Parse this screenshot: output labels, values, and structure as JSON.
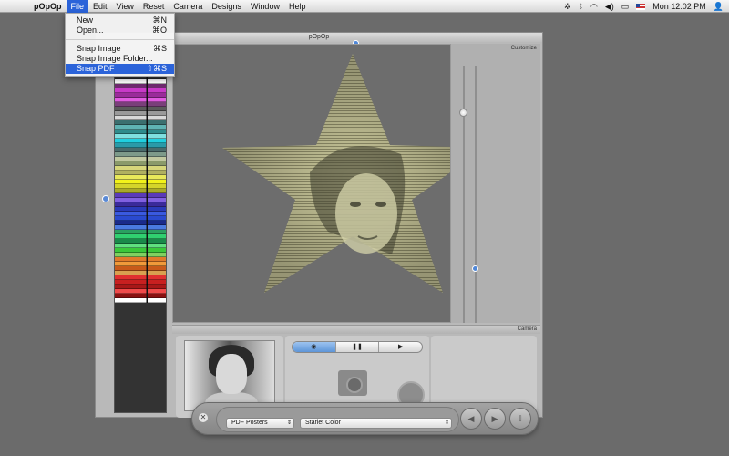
{
  "menubar": {
    "app_name": "pOpOp",
    "items": [
      "File",
      "Edit",
      "View",
      "Reset",
      "Camera",
      "Designs",
      "Window",
      "Help"
    ],
    "active": "File",
    "clock": "Mon 12:02 PM"
  },
  "file_menu": {
    "items": [
      {
        "label": "New",
        "shortcut": "⌘N"
      },
      {
        "label": "Open...",
        "shortcut": "⌘O"
      },
      {
        "label": "Snap Image",
        "shortcut": "⌘S"
      },
      {
        "label": "Snap Image Folder...",
        "shortcut": ""
      },
      {
        "label": "Snap PDF",
        "shortcut": "⇧⌘S"
      }
    ],
    "selected": "Snap PDF"
  },
  "window": {
    "title": "pOpOp",
    "customize_label": "Customize",
    "camera_label": "Camera"
  },
  "camera_controls": {
    "capture_glyph": "◉",
    "pause_glyph": "❚❚",
    "play_glyph": "▶"
  },
  "hud": {
    "close_glyph": "✕",
    "category_select": "PDF Posters",
    "style_select": "Starlet Color",
    "prev_glyph": "◀",
    "next_glyph": "▶",
    "export_glyph": "⇩"
  },
  "palette_colors": [
    "#3a3a3a",
    "#ffffff",
    "#6e2a6e",
    "#c83ac8",
    "#9a2b9a",
    "#e05ce0",
    "#7a3f7a",
    "#5a5a5a",
    "#9a9a9a",
    "#d8d8d8",
    "#3b6f6f",
    "#5fb3b3",
    "#2e8c8c",
    "#7fe0e0",
    "#1fd0e0",
    "#2a9aa8",
    "#4a6b6b",
    "#7d9a8a",
    "#c0c8a0",
    "#8a9a6a",
    "#d6d67a",
    "#b0b060",
    "#e8e85a",
    "#f2f21a",
    "#d4d42a",
    "#a8a82a",
    "#5a3ab8",
    "#8060e0",
    "#3a2a9a",
    "#2a3ab8",
    "#3a5ae0",
    "#2a4ad0",
    "#1a2a8a",
    "#4a7ae0",
    "#2aa060",
    "#30d070",
    "#1a8a4a",
    "#60e080",
    "#3ac83a",
    "#80d060",
    "#e07a2a",
    "#f09a3a",
    "#c85a1a",
    "#d8a050",
    "#e03030",
    "#c82020",
    "#a81818",
    "#f04a4a",
    "#8a1010",
    "#ffffff"
  ]
}
